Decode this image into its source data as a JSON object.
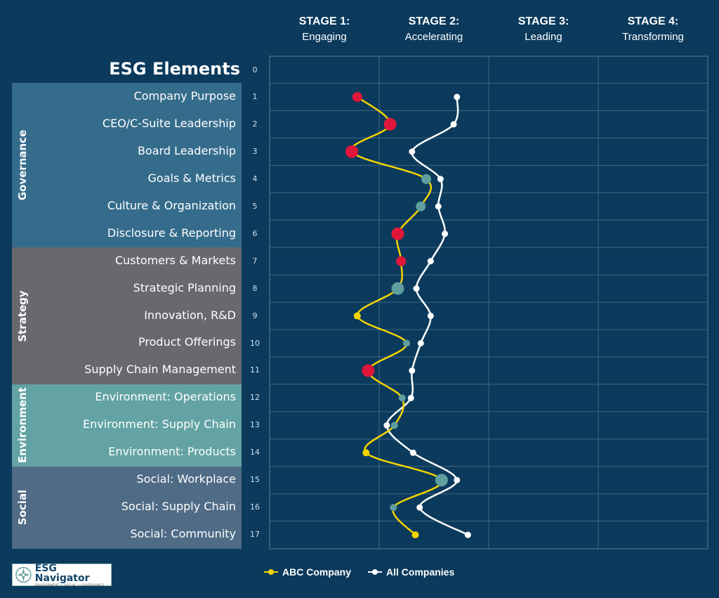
{
  "stages": [
    {
      "title": "STAGE 1:",
      "subtitle": "Engaging"
    },
    {
      "title": "STAGE 2:",
      "subtitle": "Accelerating"
    },
    {
      "title": "STAGE 3:",
      "subtitle": "Leading"
    },
    {
      "title": "STAGE 4:",
      "subtitle": "Transforming"
    }
  ],
  "title": "ESG Elements",
  "row_zero_index": "0",
  "groups": [
    {
      "name": "Governance",
      "color": "#356c8c",
      "rows": [
        1,
        2,
        3,
        4,
        5,
        6
      ]
    },
    {
      "name": "Strategy",
      "color": "#67696e",
      "rows": [
        7,
        8,
        9,
        10,
        11
      ]
    },
    {
      "name": "Environment",
      "color": "#63a3a3",
      "rows": [
        12,
        13,
        14
      ]
    },
    {
      "name": "Social",
      "color": "#4f6b86",
      "rows": [
        15,
        16,
        17
      ]
    }
  ],
  "elements": [
    {
      "index": "1",
      "label": "Company Purpose"
    },
    {
      "index": "2",
      "label": "CEO/C-Suite Leadership"
    },
    {
      "index": "3",
      "label": "Board Leadership"
    },
    {
      "index": "4",
      "label": "Goals & Metrics"
    },
    {
      "index": "5",
      "label": "Culture & Organization"
    },
    {
      "index": "6",
      "label": "Disclosure & Reporting"
    },
    {
      "index": "7",
      "label": "Customers & Markets"
    },
    {
      "index": "8",
      "label": "Strategic Planning"
    },
    {
      "index": "9",
      "label": "Innovation, R&D"
    },
    {
      "index": "10",
      "label": "Product Offerings"
    },
    {
      "index": "11",
      "label": "Supply Chain Management"
    },
    {
      "index": "12",
      "label": "Environment: Operations"
    },
    {
      "index": "13",
      "label": "Environment: Supply Chain"
    },
    {
      "index": "14",
      "label": "Environment: Products"
    },
    {
      "index": "15",
      "label": "Social: Workplace"
    },
    {
      "index": "16",
      "label": "Social: Supply Chain"
    },
    {
      "index": "17",
      "label": "Social: Community"
    }
  ],
  "legend": {
    "abc": "ABC Company",
    "all": "All Companies"
  },
  "logo": {
    "name": "ESG Navigator",
    "tagline": "ENVIRONMENT • SOCIAL • GOVERNANCE"
  },
  "colors": {
    "background": "#0b3a5c",
    "grid": "#3f6782",
    "abc_line": "#f5d400",
    "all_line": "#ffffff",
    "marker_red": "#e0173a",
    "marker_teal": "#5f9e9e",
    "marker_yellow": "#f5d400"
  },
  "chart_data": {
    "type": "line",
    "orientation": "horizontal-values-vertical-categories",
    "title": "ESG Elements",
    "xlabel": "Stage",
    "x_range": [
      0,
      4
    ],
    "x_ticks": [
      "STAGE 1: Engaging",
      "STAGE 2: Accelerating",
      "STAGE 3: Leading",
      "STAGE 4: Transforming"
    ],
    "categories": [
      "Company Purpose",
      "CEO/C-Suite Leadership",
      "Board Leadership",
      "Goals & Metrics",
      "Culture & Organization",
      "Disclosure & Reporting",
      "Customers & Markets",
      "Strategic Planning",
      "Innovation, R&D",
      "Product Offerings",
      "Supply Chain Management",
      "Environment: Operations",
      "Environment: Supply Chain",
      "Environment: Products",
      "Social: Workplace",
      "Social: Supply Chain",
      "Social: Community"
    ],
    "grid": true,
    "legend_position": "bottom",
    "series": [
      {
        "name": "ABC Company",
        "values": [
          0.8,
          1.1,
          0.75,
          1.43,
          1.38,
          1.17,
          1.2,
          1.17,
          0.8,
          1.25,
          0.9,
          1.21,
          1.14,
          0.88,
          1.57,
          1.13,
          1.33
        ],
        "marker_colors": [
          "red",
          "red",
          "red",
          "teal",
          "teal",
          "red",
          "red",
          "teal",
          "yellow",
          "teal",
          "red",
          "teal",
          "teal",
          "yellow",
          "teal",
          "teal",
          "yellow"
        ],
        "marker_sizes": [
          "medium",
          "large",
          "large",
          "medium",
          "medium",
          "large",
          "medium",
          "large",
          "small",
          "small",
          "large",
          "small",
          "small",
          "small",
          "large",
          "small",
          "small"
        ]
      },
      {
        "name": "All Companies",
        "values": [
          1.71,
          1.68,
          1.3,
          1.56,
          1.54,
          1.6,
          1.47,
          1.34,
          1.47,
          1.38,
          1.3,
          1.29,
          1.07,
          1.31,
          1.71,
          1.37,
          1.81
        ]
      }
    ]
  }
}
